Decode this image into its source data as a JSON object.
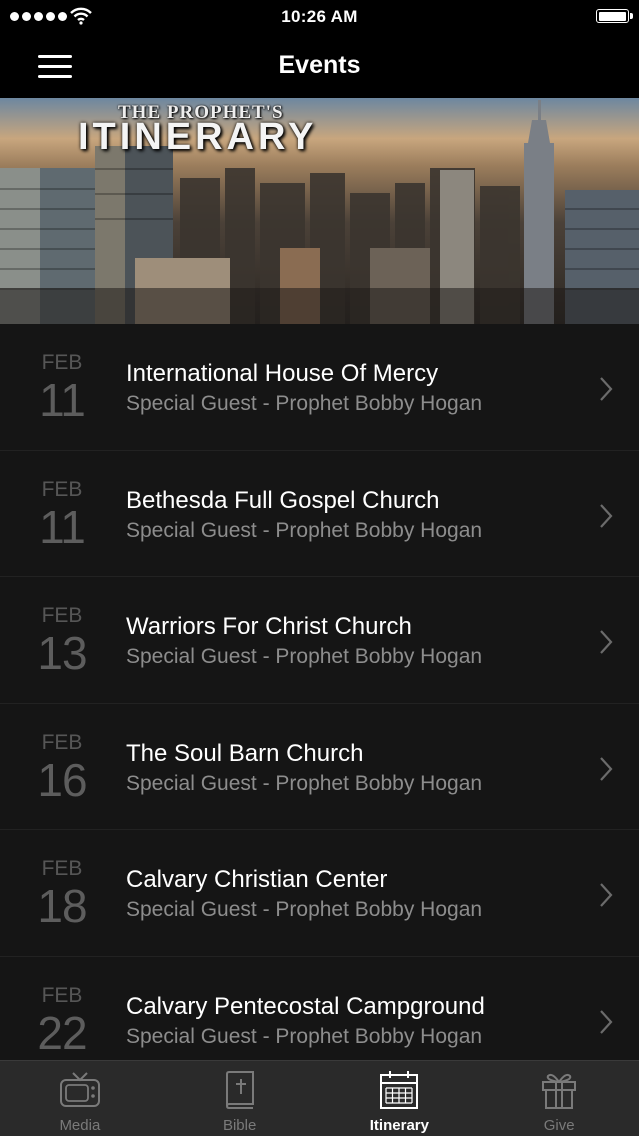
{
  "status_bar": {
    "time": "10:26 AM"
  },
  "nav": {
    "title": "Events"
  },
  "banner": {
    "line1": "THE PROPHET'S",
    "line2": "ITINERARY"
  },
  "events": [
    {
      "month": "FEB",
      "day": "11",
      "title": "International House Of Mercy",
      "subtitle": "Special Guest - Prophet Bobby Hogan"
    },
    {
      "month": "FEB",
      "day": "11",
      "title": "Bethesda Full Gospel Church",
      "subtitle": "Special Guest - Prophet Bobby Hogan"
    },
    {
      "month": "FEB",
      "day": "13",
      "title": "Warriors For Christ Church",
      "subtitle": "Special Guest - Prophet Bobby Hogan"
    },
    {
      "month": "FEB",
      "day": "16",
      "title": "The Soul Barn Church",
      "subtitle": "Special Guest - Prophet Bobby Hogan"
    },
    {
      "month": "FEB",
      "day": "18",
      "title": "Calvary Christian Center",
      "subtitle": "Special Guest - Prophet Bobby Hogan"
    },
    {
      "month": "FEB",
      "day": "22",
      "title": "Calvary Pentecostal Campground",
      "subtitle": "Special Guest - Prophet Bobby Hogan"
    }
  ],
  "tabs": [
    {
      "label": "Media",
      "icon": "tv-icon"
    },
    {
      "label": "Bible",
      "icon": "bible-icon"
    },
    {
      "label": "Itinerary",
      "icon": "calendar-icon",
      "active": true
    },
    {
      "label": "Give",
      "icon": "gift-icon"
    }
  ],
  "colors": {
    "background": "#000000",
    "row": "#151515",
    "tab_bar": "#2a2a2a",
    "active_tab": "#ffffff",
    "inactive_tab": "#7a7a7a"
  }
}
